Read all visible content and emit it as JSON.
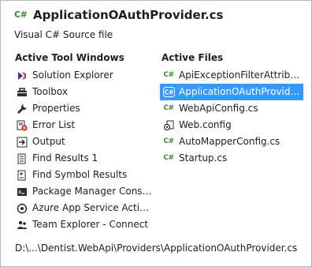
{
  "header": {
    "file_icon_text": "C#",
    "title": "ApplicationOAuthProvider.cs",
    "subtitle": "Visual C# Source file"
  },
  "tool_windows": {
    "heading": "Active Tool Windows",
    "items": [
      {
        "label": "Solution Explorer",
        "icon": "solution-explorer-icon"
      },
      {
        "label": "Toolbox",
        "icon": "toolbox-icon"
      },
      {
        "label": "Properties",
        "icon": "wrench-icon"
      },
      {
        "label": "Error List",
        "icon": "error-list-icon"
      },
      {
        "label": "Output",
        "icon": "output-icon"
      },
      {
        "label": "Find Results 1",
        "icon": "find-results-icon"
      },
      {
        "label": "Find Symbol Results",
        "icon": "find-symbol-icon"
      },
      {
        "label": "Package Manager Console",
        "icon": "console-icon"
      },
      {
        "label": "Azure App Service Activity",
        "icon": "azure-icon"
      },
      {
        "label": "Team Explorer - Connect",
        "icon": "team-explorer-icon"
      }
    ]
  },
  "active_files": {
    "heading": "Active Files",
    "selected_index": 1,
    "items": [
      {
        "label": "ApiExceptionFilterAttribute.cs",
        "icon": "csharp-file-icon",
        "icon_text": "C#"
      },
      {
        "label": "ApplicationOAuthProvider.cs",
        "icon": "csharp-file-icon",
        "icon_text": "C#"
      },
      {
        "label": "WebApiConfig.cs",
        "icon": "csharp-file-icon",
        "icon_text": "C#"
      },
      {
        "label": "Web.config",
        "icon": "config-file-icon",
        "icon_text": ""
      },
      {
        "label": "AutoMapperConfig.cs",
        "icon": "csharp-file-icon",
        "icon_text": "C#"
      },
      {
        "label": "Startup.cs",
        "icon": "csharp-file-icon",
        "icon_text": "C#"
      }
    ]
  },
  "footer": {
    "path": "D:\\...\\Dentist.WebApi\\Providers\\ApplicationOAuthProvider.cs"
  },
  "colors": {
    "selection": "#3399ff",
    "csharp_green": "#3c8a2c",
    "border": "#b8b8b8"
  }
}
